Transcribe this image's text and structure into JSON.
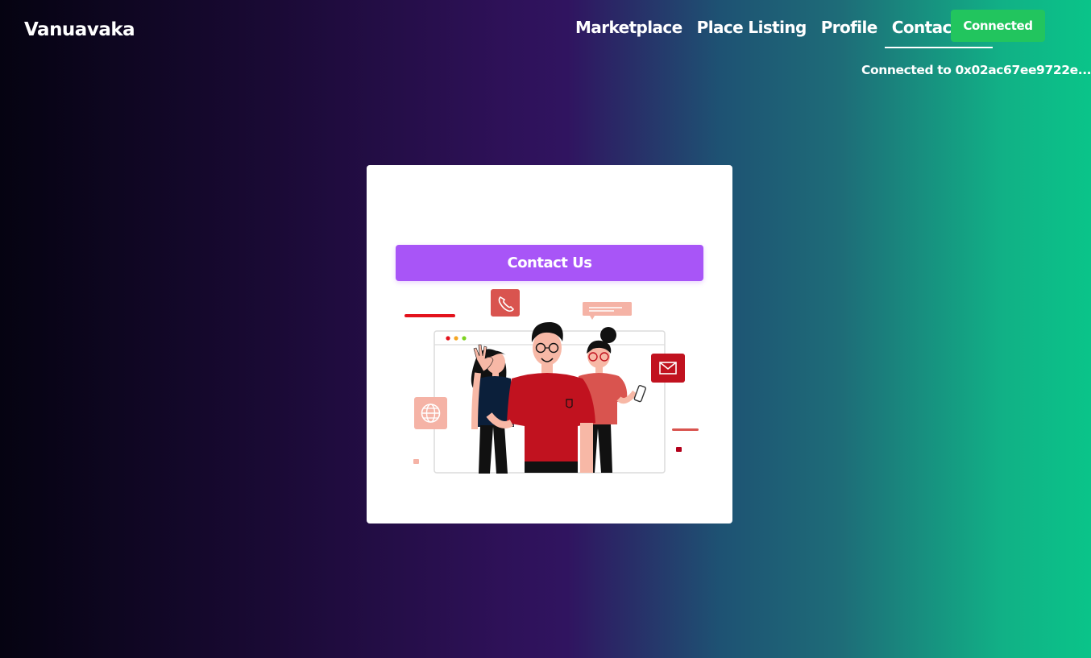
{
  "brand": "Vanuavaka",
  "nav": {
    "items": [
      {
        "label": "Marketplace",
        "active": false
      },
      {
        "label": "Place Listing",
        "active": false
      },
      {
        "label": "Profile",
        "active": false
      },
      {
        "label": "Contact Us",
        "active": true
      }
    ]
  },
  "wallet": {
    "button_label": "Connected",
    "status_text": "Connected to 0x02ac67ee9722e..."
  },
  "card": {
    "button_label": "Contact Us",
    "illustration": "contact-team-illustration"
  },
  "colors": {
    "connected_green": "#22c55e",
    "contact_purple": "#a855f7",
    "card_bg": "#ffffff",
    "accent_red": "#c1121f"
  }
}
